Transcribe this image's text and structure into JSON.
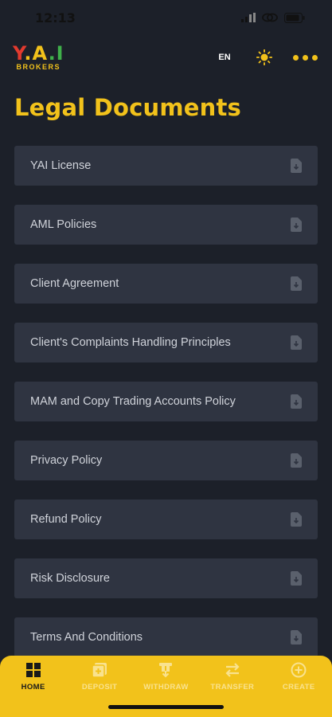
{
  "status_bar": {
    "time": "12:13"
  },
  "header": {
    "logo_text": "Y.A.I",
    "logo_subtext": "BROKERS",
    "language": "EN",
    "theme_icon": "sun-icon",
    "menu_icon": "more-dots-icon"
  },
  "page": {
    "title": "Legal Documents"
  },
  "documents": [
    {
      "label": "YAI License",
      "icon": "document-download-icon"
    },
    {
      "label": "AML Policies",
      "icon": "document-download-icon"
    },
    {
      "label": "Client Agreement",
      "icon": "document-download-icon"
    },
    {
      "label": "Client's Complaints Handling Principles",
      "icon": "document-download-icon"
    },
    {
      "label": "MAM and Copy Trading Accounts Policy",
      "icon": "document-download-icon"
    },
    {
      "label": "Privacy Policy",
      "icon": "document-download-icon"
    },
    {
      "label": "Refund Policy",
      "icon": "document-download-icon"
    },
    {
      "label": "Risk Disclosure",
      "icon": "document-download-icon"
    },
    {
      "label": "Terms And Conditions",
      "icon": "document-download-icon"
    }
  ],
  "bottom_nav": [
    {
      "label": "HOME",
      "icon": "home-grid-icon",
      "active": true
    },
    {
      "label": "DEPOSIT",
      "icon": "deposit-icon",
      "active": false
    },
    {
      "label": "WITHDRAW",
      "icon": "withdraw-icon",
      "active": false
    },
    {
      "label": "TRANSFER",
      "icon": "transfer-icon",
      "active": false
    },
    {
      "label": "CREATE",
      "icon": "create-plus-icon",
      "active": false
    }
  ],
  "colors": {
    "background": "#1c2029",
    "card": "#2f3441",
    "accent": "#f2c21b",
    "logo_red": "#e23a2e",
    "logo_green": "#3fb04a"
  }
}
